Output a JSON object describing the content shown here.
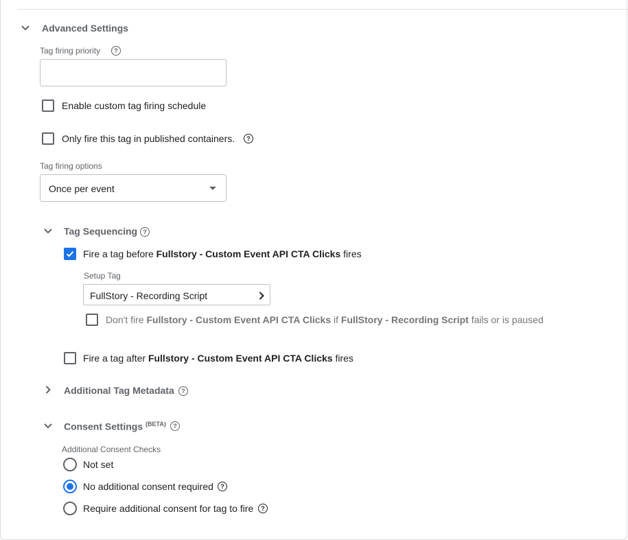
{
  "advanced": {
    "title": "Advanced Settings",
    "priority_label": "Tag firing priority",
    "priority_value": "",
    "custom_schedule_label": "Enable custom tag firing schedule",
    "published_only_label": "Only fire this tag in published containers.",
    "firing_options_label": "Tag firing options",
    "firing_options_value": "Once per event"
  },
  "sequencing": {
    "title": "Tag Sequencing",
    "before": {
      "pre": "Fire a tag before ",
      "tag": "Fullstory - Custom Event API CTA Clicks",
      "post": " fires",
      "checked": true
    },
    "setup_label": "Setup Tag",
    "setup_value": "FullStory - Recording Script",
    "dont_fire": {
      "pre": "Don't fire ",
      "tag": "Fullstory - Custom Event API CTA Clicks",
      "mid": " if ",
      "setup": "FullStory - Recording Script",
      "post": " fails or is paused"
    },
    "after": {
      "pre": "Fire a tag after ",
      "tag": "Fullstory - Custom Event API CTA Clicks",
      "post": " fires",
      "checked": false
    }
  },
  "metadata": {
    "title": "Additional Tag Metadata"
  },
  "consent": {
    "title": "Consent Settings",
    "beta": "(BETA)",
    "checks_label": "Additional Consent Checks",
    "options": [
      {
        "label": "Not set",
        "selected": false
      },
      {
        "label": "No additional consent required",
        "selected": true
      },
      {
        "label": "Require additional consent for tag to fire",
        "selected": false
      }
    ]
  },
  "colors": {
    "accent": "#1a73e8",
    "muted": "#5f6368"
  },
  "icons": {
    "help": "question-circle-icon",
    "expand": "chevron-down-icon",
    "collapsed": "chevron-right-icon",
    "nav": "chevron-right-icon"
  }
}
